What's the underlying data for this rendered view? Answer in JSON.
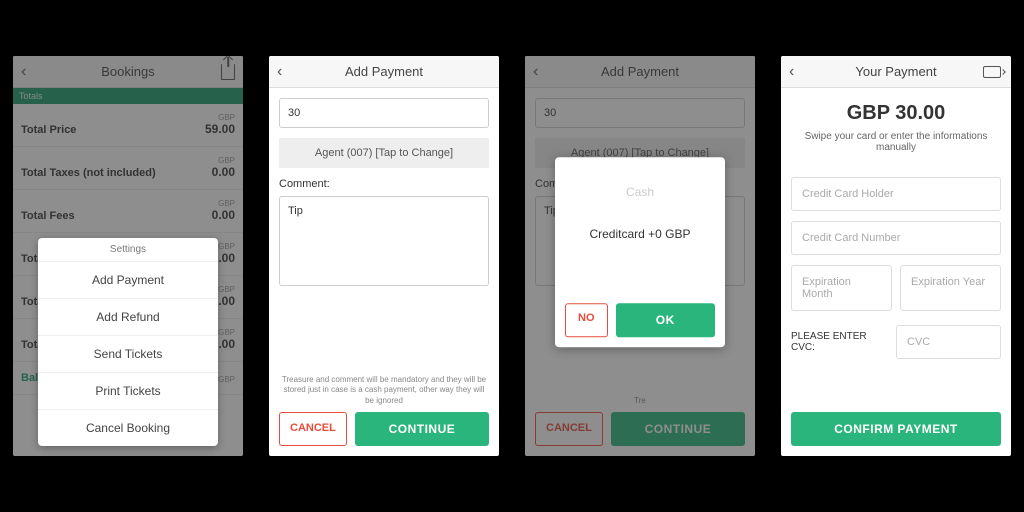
{
  "currency": "GBP",
  "screen1": {
    "title": "Bookings",
    "banner": "Totals",
    "rows": [
      {
        "label": "Total Price",
        "value": "59.00"
      },
      {
        "label": "Total Taxes (not included)",
        "value": "0.00"
      },
      {
        "label": "Total Fees",
        "value": "0.00"
      },
      {
        "label": "Tota",
        "value": "9.00"
      },
      {
        "label": "Tota",
        "value": "0.00"
      },
      {
        "label": "Tota",
        "value": "0.00"
      }
    ],
    "balance_label": "Bala",
    "menu_title": "Settings",
    "menu_items": [
      "Add Payment",
      "Add Refund",
      "Send Tickets",
      "Print Tickets",
      "Cancel Booking"
    ]
  },
  "screen2": {
    "title": "Add Payment",
    "amount": "30",
    "agent_text": "Agent (007) [Tap to Change]",
    "comment_label": "Comment:",
    "comment_value": "Tip",
    "disclaimer": "Treasure and comment will be mandatory and they will be stored just in case is a cash payment, other way they will be ignored",
    "cancel": "CANCEL",
    "continue": "CONTINUE"
  },
  "screen3": {
    "title": "Add Payment",
    "amount": "30",
    "agent_text": "Agent (007) [Tap to Change]",
    "comment_label": "Comment:",
    "comment_value": "Tip",
    "disclaimer_partial": "Tre",
    "modal_cash": "Cash",
    "modal_credit": "Creditcard +0 GBP",
    "no": "NO",
    "ok": "OK"
  },
  "screen4": {
    "title": "Your Payment",
    "amount": "GBP 30.00",
    "subtitle": "Swipe your card or enter the informations manually",
    "placeholders": {
      "holder": "Credit Card Holder",
      "number": "Credit Card Number",
      "exp_m": "Expiration Month",
      "exp_y": "Expiration Year",
      "cvc": "CVC"
    },
    "cvc_label": "PLEASE ENTER CVC:",
    "confirm": "CONFIRM PAYMENT"
  }
}
